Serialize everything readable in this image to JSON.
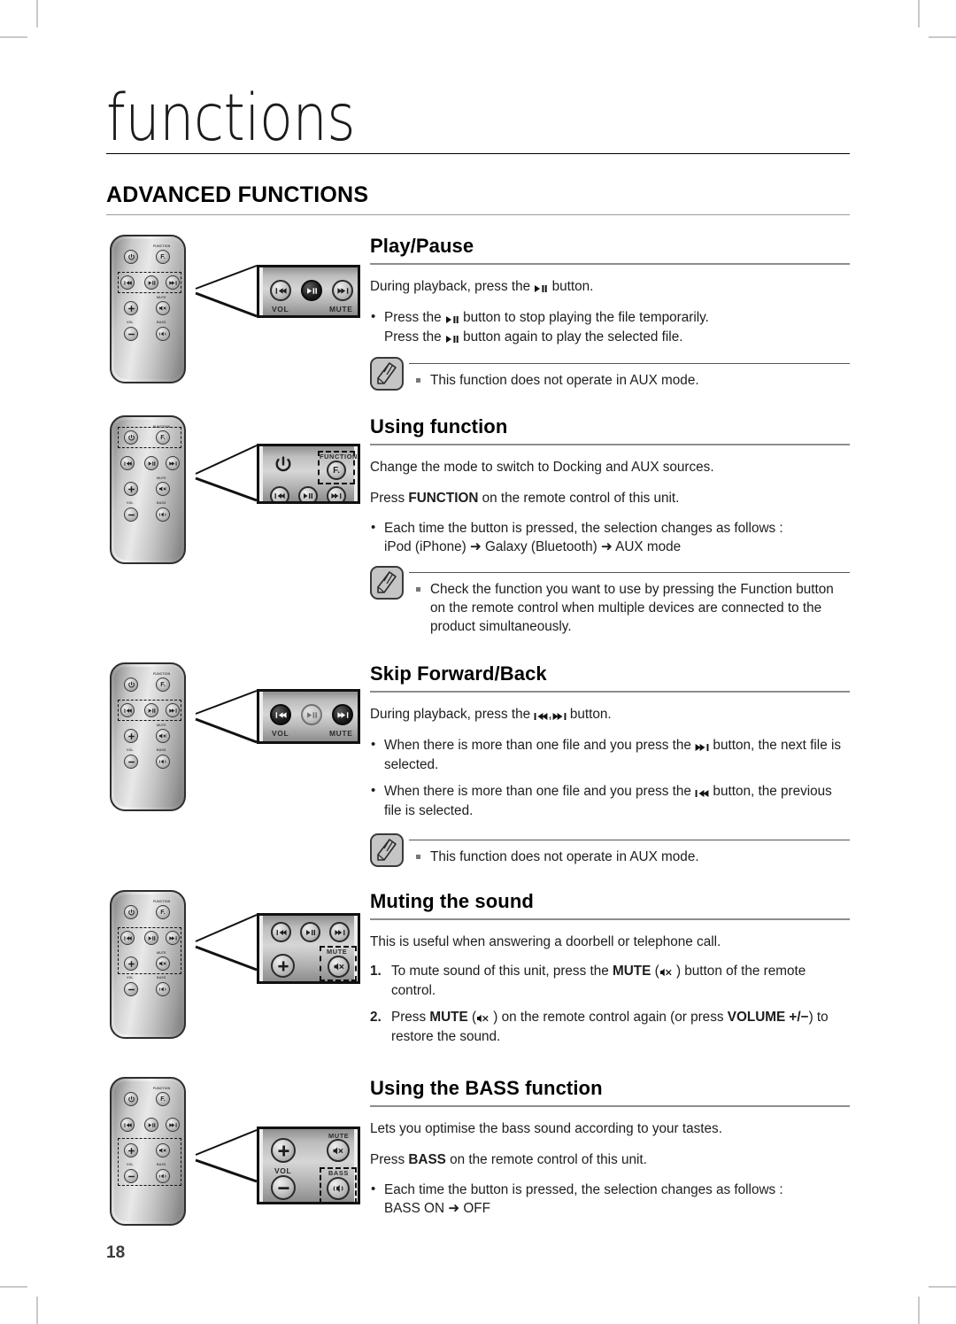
{
  "page": {
    "chapter_title": "functions",
    "section_title": "ADVANCED FUNCTIONS",
    "page_number": "18"
  },
  "sections": [
    {
      "id": "play-pause",
      "heading": "Play/Pause",
      "intro": "During playback, press the ▶❙❙ button.",
      "intro_parts": [
        "During playback, press the ",
        " button."
      ],
      "bullets": [
        "Press the ▶❙❙ button to stop playing the file temporarily. Press the ▶❙❙ button again to play the selected file."
      ],
      "bullet_lines": [
        [
          "Press the ",
          " button to stop playing the file temporarily."
        ],
        [
          "Press the ",
          " button again to play the selected file."
        ]
      ],
      "note": "This function does not operate in AUX mode."
    },
    {
      "id": "using-function",
      "heading": "Using function",
      "intro": "Change the mode to switch to Docking and AUX sources.",
      "intro2_pre": "Press ",
      "intro2_bold": "FUNCTION",
      "intro2_post": " on the remote control of this unit.",
      "bullet_line1": "Each time the button is pressed, the selection changes as follows :",
      "bullet_line2": "iPod (iPhone) ➜ Galaxy (Bluetooth) ➜ AUX mode",
      "note": "Check the function you want to use by pressing the Function button on the remote control when multiple devices are connected to the product simultaneously."
    },
    {
      "id": "skip-forward-back",
      "heading": "Skip Forward/Back",
      "intro_pre": "During playback, press the ",
      "intro_mid": ",",
      "intro_post": " button.",
      "bullets": [
        {
          "pre": "When there is more than one file and you press the ",
          "post": " button, the next file is selected.",
          "glyph": "next"
        },
        {
          "pre": "When there is more than one file and you press the ",
          "post": " button, the previous file is selected.",
          "glyph": "prev"
        }
      ],
      "note": "This function does not operate in AUX mode."
    },
    {
      "id": "muting-the-sound",
      "heading": "Muting the sound",
      "intro": "This is useful when answering a doorbell or telephone call.",
      "steps": [
        {
          "pre": "To mute sound of this unit, press the ",
          "bold": "MUTE",
          "post": " ) button of the remote control."
        },
        {
          "pre": "Press ",
          "bold": "MUTE",
          "mid": " ) on the remote control again (or press ",
          "bold2": "VOLUME +/−",
          "post": ") to restore the sound."
        }
      ]
    },
    {
      "id": "using-the-bass-function",
      "heading": "Using the BASS function",
      "intro": "Lets you optimise the bass sound according to your tastes.",
      "intro2_pre": "Press ",
      "intro2_bold": "BASS",
      "intro2_post": " on the remote control of this unit.",
      "bullet_line1": "Each time the button is pressed, the selection changes as follows :",
      "bullet_line2": "BASS ON ➜ OFF"
    }
  ],
  "remote": {
    "labels": {
      "function": "FUNCTION",
      "vol": "VOL",
      "bass": "BASS",
      "mute": "MUTE"
    },
    "buttons": [
      "power-button",
      "function-button",
      "skip-back-button",
      "play-pause-button",
      "skip-forward-button",
      "volume-up-button",
      "mute-button",
      "volume-down-button",
      "bass-button"
    ]
  },
  "callouts": {
    "play_pause": {
      "labels": [
        "VOL",
        "MUTE"
      ],
      "highlight": "play-pause-button"
    },
    "using_function": {
      "labels": [
        "FUNCTION"
      ],
      "highlight": "function-button"
    },
    "skip": {
      "labels": [
        "VOL",
        "MUTE"
      ],
      "highlight": "skip-buttons"
    },
    "mute": {
      "labels": [
        "MUTE"
      ],
      "highlight": "mute-button"
    },
    "bass": {
      "labels": [
        "MUTE",
        "VOL",
        "BASS"
      ],
      "highlight": "bass-button"
    }
  },
  "colors": {
    "text": "#1d1d1d",
    "rule": "#8d8d8d",
    "note_icon_bg": "#c5c5c5"
  }
}
